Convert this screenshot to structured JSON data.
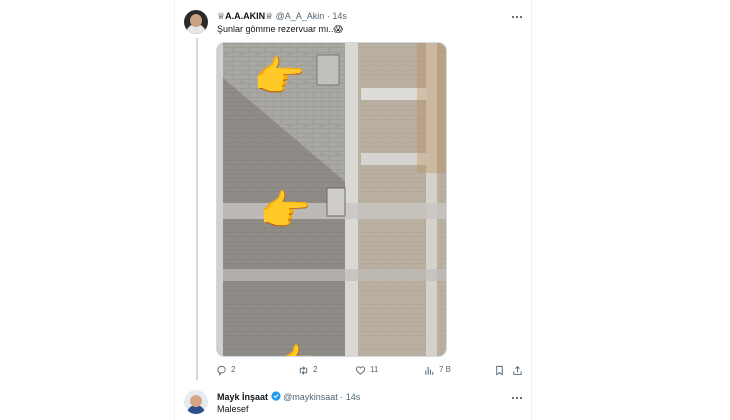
{
  "tweet": {
    "display_name": "♕A.A.AKIN♕",
    "handle": "@A_A_Akin",
    "time": "· 14s",
    "text": "Şunlar gömme rezervuar mı..",
    "emoji": "😱",
    "actions": {
      "reply_count": "2",
      "retweet_count": "2",
      "like_count": "11",
      "view_count": "7 B"
    },
    "media": {
      "pointer_emoji": "👉"
    }
  },
  "reply": {
    "display_name": "Mayk İnşaat",
    "handle": "@maykinsaat",
    "time": "· 14s",
    "text": "Malesef",
    "verified": true
  },
  "icons": {
    "more": "more-icon",
    "reply": "reply-icon",
    "retweet": "retweet-icon",
    "like": "like-icon",
    "views": "views-icon",
    "bookmark": "bookmark-icon",
    "share": "share-icon",
    "verified": "verified-badge-icon"
  },
  "colors": {
    "text": "#0f1419",
    "muted": "#536471",
    "verified": "#1d9bf0",
    "border": "#cfd9de"
  }
}
